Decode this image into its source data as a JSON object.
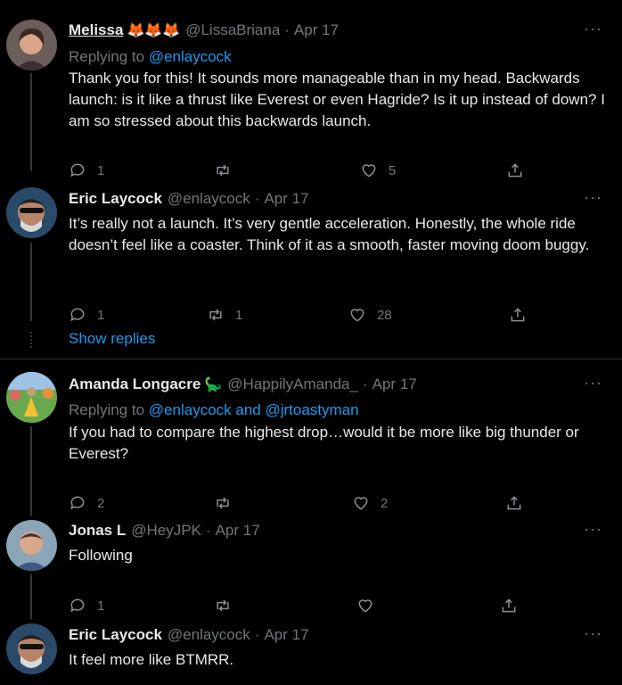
{
  "tweets": [
    {
      "name": "Melissa",
      "emoji": "🦊🦊🦊",
      "handle": "@LissaBriana",
      "date": "Apr 17",
      "replying_label": "Replying to",
      "replying_to": "@enlaycock",
      "text": "Thank you for this! It sounds more manageable than in my head. Backwards launch: is it like a thrust like Everest or even Hagride? Is it up instead of down? I am so stressed about this backwards launch.",
      "replies": "1",
      "retweets": "",
      "likes": "5"
    },
    {
      "name": "Eric Laycock",
      "handle": "@enlaycock",
      "date": "Apr 17",
      "text": "It’s really not a launch. It’s very gentle acceleration. Honestly, the whole ride doesn’t feel like a coaster. Think of it as a smooth, faster moving doom buggy.",
      "replies": "1",
      "retweets": "1",
      "likes": "28"
    },
    {
      "name": "Amanda Longacre",
      "emoji": "🦕",
      "handle": "@HappilyAmanda_",
      "date": "Apr 17",
      "replying_label": "Replying to",
      "replying_to": "@enlaycock and @jrtoastyman",
      "text": "If you had to compare the highest drop…would it be more like big thunder or Everest?",
      "replies": "2",
      "retweets": "",
      "likes": "2"
    },
    {
      "name": "Jonas L",
      "handle": "@HeyJPK",
      "date": "Apr 17",
      "text": "Following",
      "replies": "1",
      "retweets": "",
      "likes": ""
    },
    {
      "name": "Eric Laycock",
      "handle": "@enlaycock",
      "date": "Apr 17",
      "text": "It feel more like BTMRR."
    }
  ],
  "show_replies": "Show replies",
  "dot": "·",
  "more": "···",
  "colors": {
    "background": "#000000",
    "link": "#1d9bf0",
    "muted": "#71767b",
    "text": "#e7e9ea"
  }
}
